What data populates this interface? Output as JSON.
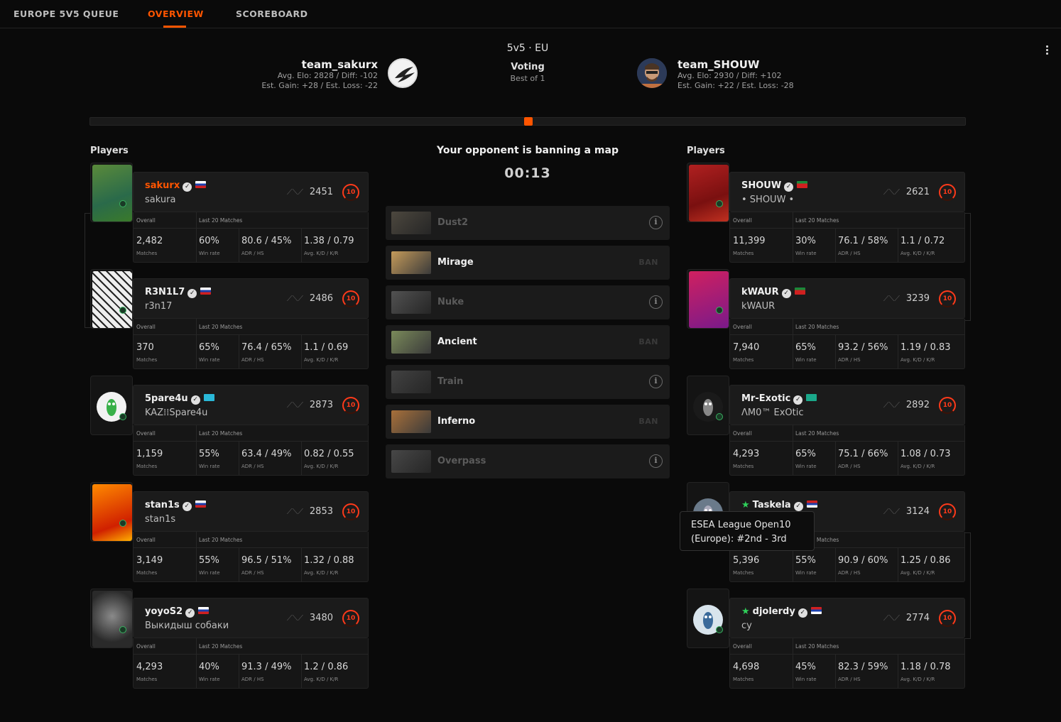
{
  "nav": {
    "queue": "EUROPE 5V5 QUEUE",
    "overview": "OVERVIEW",
    "scoreboard": "SCOREBOARD"
  },
  "match": {
    "mode": "5v5 · EU",
    "status": "Voting",
    "format": "Best of 1"
  },
  "team_left": {
    "name": "team_sakurx",
    "line1": "Avg. Elo: 2828 / Diff: -102",
    "line2": "Est. Gain: +28 / Est. Loss: -22"
  },
  "team_right": {
    "name": "team_SHOUW",
    "line1": "Avg. Elo: 2930 / Diff: +102",
    "line2": "Est. Gain: +22 / Est. Loss: -28"
  },
  "labels": {
    "players_left": "Players",
    "players_right": "Players",
    "overall": "Overall",
    "last20": "Last 20 Matches",
    "matches": "Matches",
    "winrate": "Win rate",
    "adr": "ADR / HS",
    "kd": "Avg. K/D / K/R"
  },
  "voting": {
    "title": "Your opponent is banning a map",
    "timer": "00:13"
  },
  "maps": [
    {
      "name": "Dust2",
      "state": "dim",
      "action": "i"
    },
    {
      "name": "Mirage",
      "state": "active",
      "action": "BAN"
    },
    {
      "name": "Nuke",
      "state": "dim",
      "action": "i"
    },
    {
      "name": "Ancient",
      "state": "active",
      "action": "BAN"
    },
    {
      "name": "Train",
      "state": "dim",
      "action": "i"
    },
    {
      "name": "Inferno",
      "state": "active",
      "action": "BAN"
    },
    {
      "name": "Overpass",
      "state": "dim",
      "action": "i"
    }
  ],
  "left_players": [
    {
      "name": "sakurx",
      "sub": "sakura",
      "elo": "2451",
      "level": "10",
      "matches": "2,482",
      "winrate": "60%",
      "adr": "80.6 / 45%",
      "kd": "1.38 / 0.79"
    },
    {
      "name": "R3N1L7",
      "sub": "r3n17",
      "elo": "2486",
      "level": "10",
      "matches": "370",
      "winrate": "65%",
      "adr": "76.4 / 65%",
      "kd": "1.1 / 0.69"
    },
    {
      "name": "5pare4u",
      "sub": "KAZ⁞⁞Spare4u",
      "elo": "2873",
      "level": "10",
      "matches": "1,159",
      "winrate": "55%",
      "adr": "63.4 / 49%",
      "kd": "0.82 / 0.55"
    },
    {
      "name": "stan1s",
      "sub": "stan1s",
      "elo": "2853",
      "level": "10",
      "matches": "3,149",
      "winrate": "55%",
      "adr": "96.5 / 51%",
      "kd": "1.32 / 0.88"
    },
    {
      "name": "yoyoS2",
      "sub": "Выкидыш собаки",
      "elo": "3480",
      "level": "10",
      "matches": "4,293",
      "winrate": "40%",
      "adr": "91.3 / 49%",
      "kd": "1.2 / 0.86"
    }
  ],
  "right_players": [
    {
      "name": "SHOUW",
      "sub": "• SHOUW •",
      "elo": "2621",
      "level": "10",
      "matches": "11,399",
      "winrate": "30%",
      "adr": "76.1 / 58%",
      "kd": "1.1 / 0.72"
    },
    {
      "name": "kWAUR",
      "sub": "kWAUR",
      "elo": "3239",
      "level": "10",
      "matches": "7,940",
      "winrate": "65%",
      "adr": "93.2 / 56%",
      "kd": "1.19 / 0.83"
    },
    {
      "name": "Mr-Exotic",
      "sub": "ΛM0™ ExOtic",
      "elo": "2892",
      "level": "10",
      "matches": "4,293",
      "winrate": "65%",
      "adr": "75.1 / 66%",
      "kd": "1.08 / 0.73"
    },
    {
      "name": "Taskela",
      "sub": "",
      "elo": "3124",
      "level": "10",
      "matches": "5,396",
      "winrate": "55%",
      "adr": "90.9 / 60%",
      "kd": "1.25 / 0.86"
    },
    {
      "name": "djolerdy",
      "sub": "cy",
      "elo": "2774",
      "level": "10",
      "matches": "4,698",
      "winrate": "45%",
      "adr": "82.3 / 59%",
      "kd": "1.18 / 0.78"
    }
  ],
  "tooltip": {
    "line1": "ESEA League Open10",
    "line2": "(Europe): #2nd - 3rd"
  },
  "colors": {
    "accent": "#ff5500",
    "level": "#ff3a1a",
    "background": "#0a0a0a"
  }
}
